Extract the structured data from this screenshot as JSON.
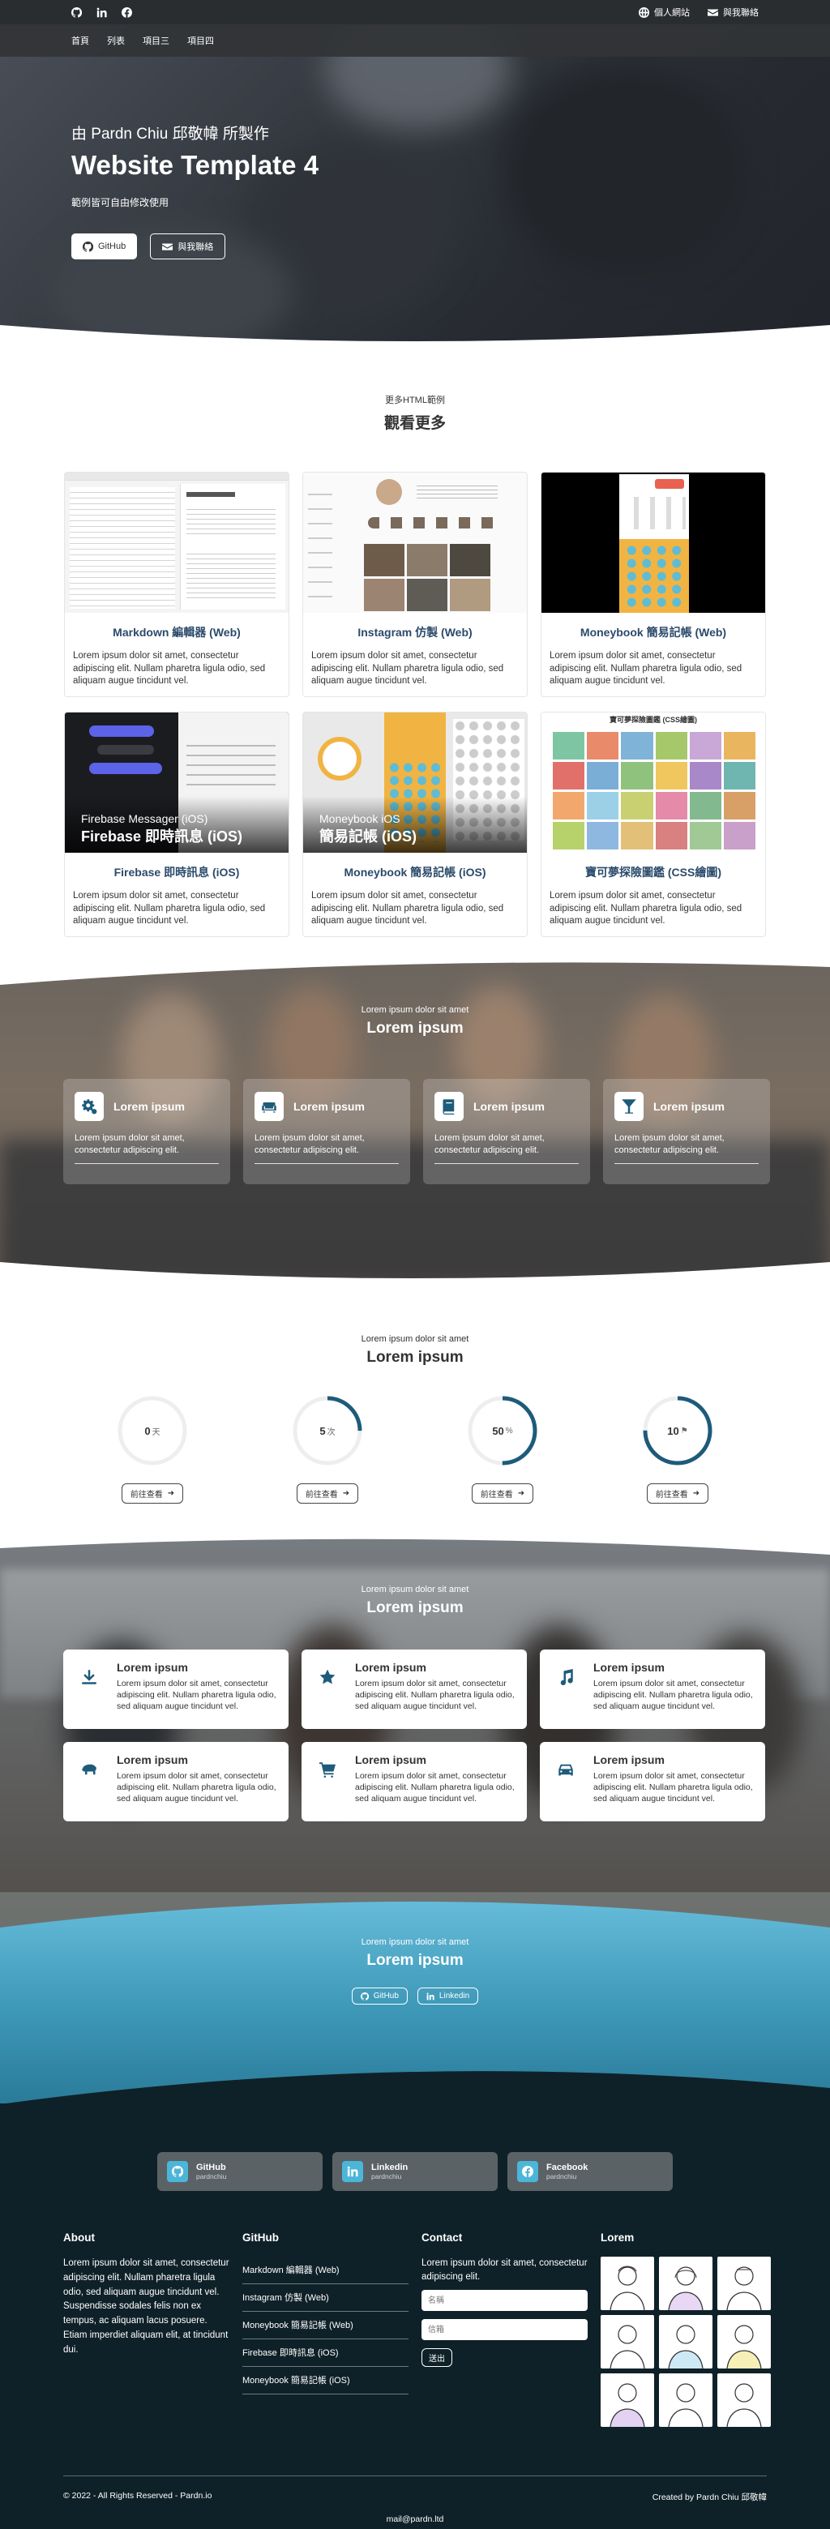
{
  "topbar": {
    "site_label": "個人網站",
    "contact_label": "與我聯絡"
  },
  "nav": {
    "items": [
      "首頁",
      "列表",
      "項目三",
      "項目四"
    ]
  },
  "hero": {
    "by": "由 Pardn Chiu 邱敬幃 所製作",
    "title": "Website Template 4",
    "subtitle": "範例皆可自由修改使用",
    "github_btn": "GitHub",
    "contact_btn": "與我聯絡"
  },
  "more": {
    "eyebrow": "更多HTML範例",
    "title": "觀看更多",
    "cards": [
      {
        "title": "Markdown 編輯器 (Web)",
        "text": "Lorem ipsum dolor sit amet, consectetur adipiscing elit. Nullam pharetra ligula odio, sed aliquam augue tincidunt vel."
      },
      {
        "title": "Instagram 仿製 (Web)",
        "text": "Lorem ipsum dolor sit amet, consectetur adipiscing elit. Nullam pharetra ligula odio, sed aliquam augue tincidunt vel."
      },
      {
        "title": "Moneybook 簡易記帳 (Web)",
        "text": "Lorem ipsum dolor sit amet, consectetur adipiscing elit. Nullam pharetra ligula odio, sed aliquam augue tincidunt vel."
      },
      {
        "title": "Firebase 即時訊息 (iOS)",
        "text": "Lorem ipsum dolor sit amet, consectetur adipiscing elit. Nullam pharetra ligula odio, sed aliquam augue tincidunt vel.",
        "cap_a": "Firebase Messager (iOS)",
        "cap_b": "Firebase 即時訊息 (iOS)"
      },
      {
        "title": "Moneybook 簡易記帳 (iOS)",
        "text": "Lorem ipsum dolor sit amet, consectetur adipiscing elit. Nullam pharetra ligula odio, sed aliquam augue tincidunt vel.",
        "cap_a": "Moneybook iOS",
        "cap_b": "簡易記帳 (iOS)"
      },
      {
        "title": "寶可夢探險圖鑑 (CSS繪圖)",
        "text": "Lorem ipsum dolor sit amet, consectetur adipiscing elit. Nullam pharetra ligula odio, sed aliquam augue tincidunt vel.",
        "thumb_title": "寶可夢探險圖鑑 (CSS繪圖)"
      }
    ]
  },
  "features": {
    "eyebrow": "Lorem ipsum dolor sit amet",
    "title": "Lorem ipsum",
    "cards": [
      {
        "icon": "gears-icon",
        "title": "Lorem ipsum",
        "text": "Lorem ipsum dolor sit amet, consectetur adipiscing elit."
      },
      {
        "icon": "couch-icon",
        "title": "Lorem ipsum",
        "text": "Lorem ipsum dolor sit amet, consectetur adipiscing elit."
      },
      {
        "icon": "book-icon",
        "title": "Lorem ipsum",
        "text": "Lorem ipsum dolor sit amet, consectetur adipiscing elit."
      },
      {
        "icon": "cocktail-icon",
        "title": "Lorem ipsum",
        "text": "Lorem ipsum dolor sit amet, consectetur adipiscing elit."
      }
    ]
  },
  "progress": {
    "eyebrow": "Lorem ipsum dolor sit amet",
    "title": "Lorem ipsum",
    "button": "前往查看",
    "items": [
      {
        "value": "0",
        "unit": "天",
        "fraction": 0.0
      },
      {
        "value": "5",
        "unit": "次",
        "fraction": 0.25
      },
      {
        "value": "50",
        "unit": "%",
        "fraction": 0.5
      },
      {
        "value": "10",
        "unit": "⚑",
        "fraction": 0.75
      }
    ],
    "accent": "#1e5b7a"
  },
  "services": {
    "eyebrow": "Lorem ipsum dolor sit amet",
    "title": "Lorem ipsum",
    "cards": [
      {
        "icon": "download-icon",
        "title": "Lorem ipsum",
        "text": "Lorem ipsum dolor sit amet, consectetur adipiscing elit. Nullam pharetra ligula odio, sed aliquam augue tincidunt vel."
      },
      {
        "icon": "star-icon",
        "title": "Lorem ipsum",
        "text": "Lorem ipsum dolor sit amet, consectetur adipiscing elit. Nullam pharetra ligula odio, sed aliquam augue tincidunt vel."
      },
      {
        "icon": "music-icon",
        "title": "Lorem ipsum",
        "text": "Lorem ipsum dolor sit amet, consectetur adipiscing elit. Nullam pharetra ligula odio, sed aliquam augue tincidunt vel."
      },
      {
        "icon": "hippo-icon",
        "title": "Lorem ipsum",
        "text": "Lorem ipsum dolor sit amet, consectetur adipiscing elit. Nullam pharetra ligula odio, sed aliquam augue tincidunt vel."
      },
      {
        "icon": "cart-icon",
        "title": "Lorem ipsum",
        "text": "Lorem ipsum dolor sit amet, consectetur adipiscing elit. Nullam pharetra ligula odio, sed aliquam augue tincidunt vel."
      },
      {
        "icon": "car-icon",
        "title": "Lorem ipsum",
        "text": "Lorem ipsum dolor sit amet, consectetur adipiscing elit. Nullam pharetra ligula odio, sed aliquam augue tincidunt vel."
      }
    ]
  },
  "cta": {
    "eyebrow": "Lorem ipsum dolor sit amet",
    "title": "Lorem ipsum",
    "github": "GitHub",
    "linkedin": "Linkedin"
  },
  "footer": {
    "social": [
      {
        "name": "GitHub",
        "handle": "pardnchiu",
        "icon": "github-icon"
      },
      {
        "name": "Linkedin",
        "handle": "pardnchiu",
        "icon": "linkedin-icon"
      },
      {
        "name": "Facebook",
        "handle": "pardnchiu",
        "icon": "facebook-icon"
      }
    ],
    "about": {
      "title": "About",
      "text": "Lorem ipsum dolor sit amet, consectetur adipiscing elit. Nullam pharetra ligula odio, sed aliquam augue tincidunt vel. Suspendisse sodales felis non ex tempus, ac aliquam lacus posuere. Etiam imperdiet aliquam elit, at tincidunt dui."
    },
    "github": {
      "title": "GitHub",
      "links": [
        "Markdown 編輯器 (Web)",
        "Instagram 仿製 (Web)",
        "Moneybook 簡易記帳 (Web)",
        "Firebase 即時訊息 (iOS)",
        "Moneybook 簡易記帳 (iOS)"
      ]
    },
    "contact": {
      "title": "Contact",
      "text": "Lorem ipsum dolor sit amet, consectetur adipiscing elit.",
      "name_placeholder": "名稱",
      "email_placeholder": "信箱",
      "send": "送出"
    },
    "gallery": {
      "title": "Lorem"
    },
    "copyright": "© 2022 - All Rights Reserved - Pardn.io",
    "created_by": "Created by Pardn Chiu 邱敬幃",
    "mail": "mail@pardn.ltd"
  }
}
